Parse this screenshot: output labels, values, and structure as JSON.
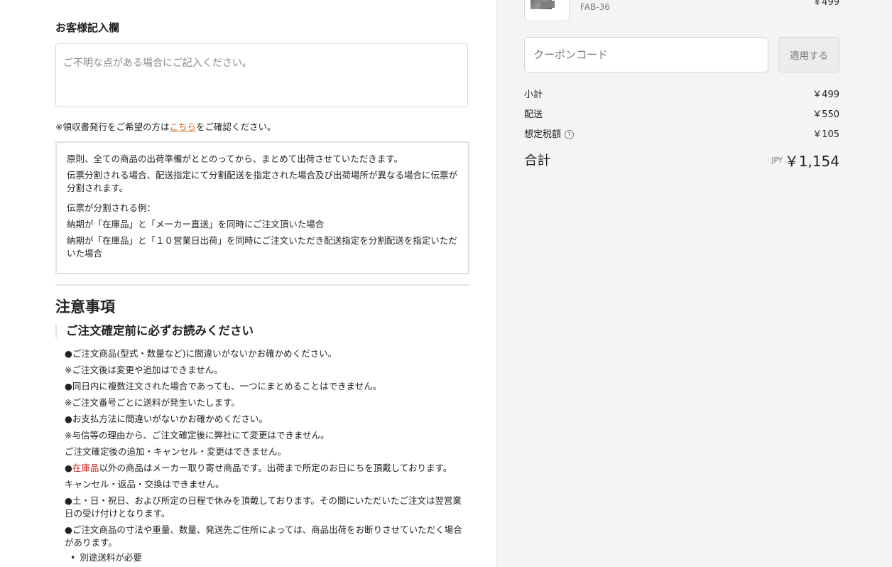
{
  "form": {
    "memo_label": "お客様記入欄",
    "memo_placeholder": "ご不明な点がある場合にご記入ください。",
    "receipt_prefix": "※領収書発行をご希望の方は",
    "receipt_link": "こちら",
    "receipt_suffix": "をご確認ください。"
  },
  "shipping_info": {
    "lines": [
      "原則、全ての商品の出荷準備がととのってから、まとめて出荷させていただきます。",
      "伝票分割される場合、配送指定にて分割配送を指定された場合及び出荷場所が異なる場合に伝票が分割されます。",
      "伝票が分割される例：",
      "納期が「在庫品」と「メーカー直送」を同時にご注文頂いた場合",
      "納期が「在庫品」と「１０営業日出荷」を同時にご注文いただき配送指定を分割配送を指定いただいた場合"
    ]
  },
  "notice": {
    "title": "注意事項",
    "subtitle": "ご注文確定前に必ずお読みください",
    "lines": [
      "●ご注文商品(型式・数量など)に間違いがないかお確かめください。",
      "※ご注文後は変更や追加はできません。",
      "●同日内に複数注文された場合であっても、一つにまとめることはできません。",
      "※ご注文番号ごとに送料が発生いたします。",
      "●お支払方法に間違いがないかお確かめください。",
      "※与信等の理由から、ご注文確定後に弊社にて変更はできません。",
      "ご注文確定後の追加・キャンセル・変更はできません。",
      "以外の商品はメーカー取り寄せ商品です。出荷まで所定のお日にちを頂戴しております。",
      "キャンセル・返品・交換はできません。",
      "●土・日・祝日、および所定の日程で休みを頂戴しております。その間にいただいたご注文は翌営業日の受け付けとなります。",
      "●ご注文商品の寸法や重量、数量、発送先ご住所によっては、商品出荷をお断りさせていただく場合があります。",
      "別途送料が必要"
    ],
    "red_prefix_bullet": "●",
    "red_word": "在庫品"
  },
  "summary": {
    "item_sku": "FAB-36",
    "item_price": "￥499",
    "coupon_placeholder": "クーポンコード",
    "apply_label": "適用する",
    "subtotal_label": "小計",
    "subtotal_value": "￥499",
    "shipping_label": "配送",
    "shipping_value": "￥550",
    "tax_label": "想定税額",
    "tax_value": "￥105",
    "total_label": "合計",
    "currency": "JPY",
    "total_value": "￥1,154",
    "help_icon": "question-circle-icon",
    "accent_link_color": "#d2691e",
    "warning_red": "#cc2222"
  }
}
